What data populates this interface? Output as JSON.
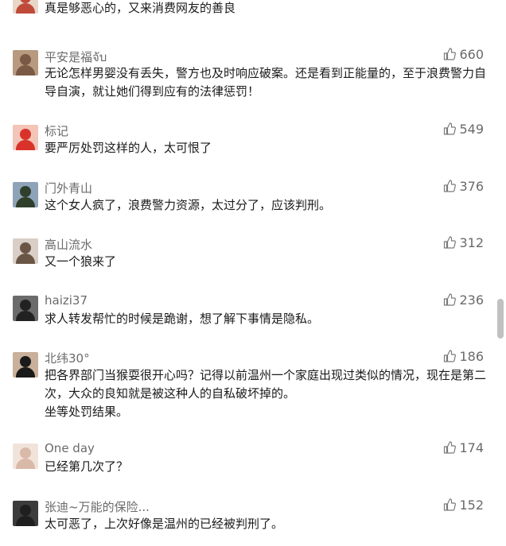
{
  "comments": [
    {
      "user": "",
      "likes": "",
      "text": "真是够恶心的，又来消费网友的善良",
      "avatar_colors": [
        "#c04a3a",
        "#e8d6c8"
      ]
    },
    {
      "user": "平安是福จับ",
      "likes": "660",
      "text": "无论怎样男婴没有丢失，警方也及时响应破案。还是看到正能量的，至于浪费警力自导自演，就让她们得到应有的法律惩罚！",
      "avatar_colors": [
        "#7a5a44",
        "#b89a80"
      ]
    },
    {
      "user": "标记",
      "likes": "549",
      "text": "要严厉处罚这样的人，太可恨了",
      "avatar_colors": [
        "#d8322a",
        "#f3c4b8"
      ]
    },
    {
      "user": "门外青山",
      "likes": "376",
      "text": "这个女人疯了，浪费警力资源，太过分了，应该判刑。",
      "avatar_colors": [
        "#2f3f2c",
        "#8fa3b8"
      ]
    },
    {
      "user": "高山流水",
      "likes": "312",
      "text": "又一个狼来了",
      "avatar_colors": [
        "#6b5646",
        "#d9cfc6"
      ]
    },
    {
      "user": "haizi37",
      "likes": "236",
      "text": "求人转发帮忙的时候是跪谢，想了解下事情是隐私。",
      "avatar_colors": [
        "#222222",
        "#6b6b6b"
      ]
    },
    {
      "user": "北纬30°",
      "likes": "186",
      "text": "把各界部门当猴耍很开心吗？记得以前温州一个家庭出现过类似的情况，现在是第二次，大众的良知就是被这种人的自私破坏掉的。\n坐等处罚结果。",
      "avatar_colors": [
        "#1a1a1a",
        "#c9b09a"
      ]
    },
    {
      "user": "One day",
      "likes": "174",
      "text": "已经第几次了？",
      "avatar_colors": [
        "#d9b9a8",
        "#f2e3da"
      ]
    },
    {
      "user": "张迪~万能的保险...",
      "likes": "152",
      "text": "太可恶了，上次好像是温州的已经被判刑了。",
      "avatar_colors": [
        "#1f1f1f",
        "#3c3c3c"
      ]
    }
  ]
}
